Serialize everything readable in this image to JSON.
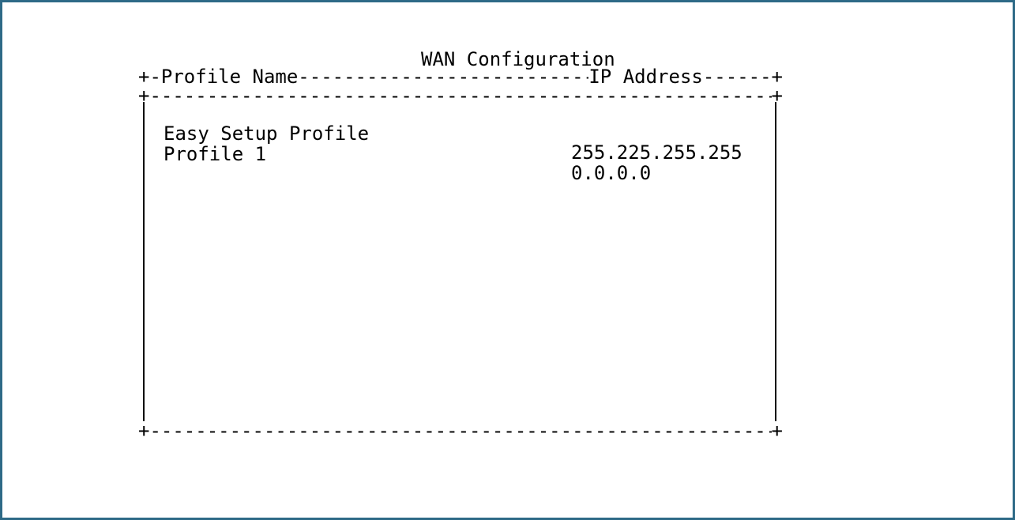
{
  "title": "WAN Configuration",
  "columns": {
    "name": "Profile Name",
    "ip": "IP Address"
  },
  "profiles": [
    {
      "name": "Easy Setup Profile",
      "ip": "255.225.255.255"
    },
    {
      "name": "Profile 1",
      "ip": "0.0.0.0"
    }
  ]
}
